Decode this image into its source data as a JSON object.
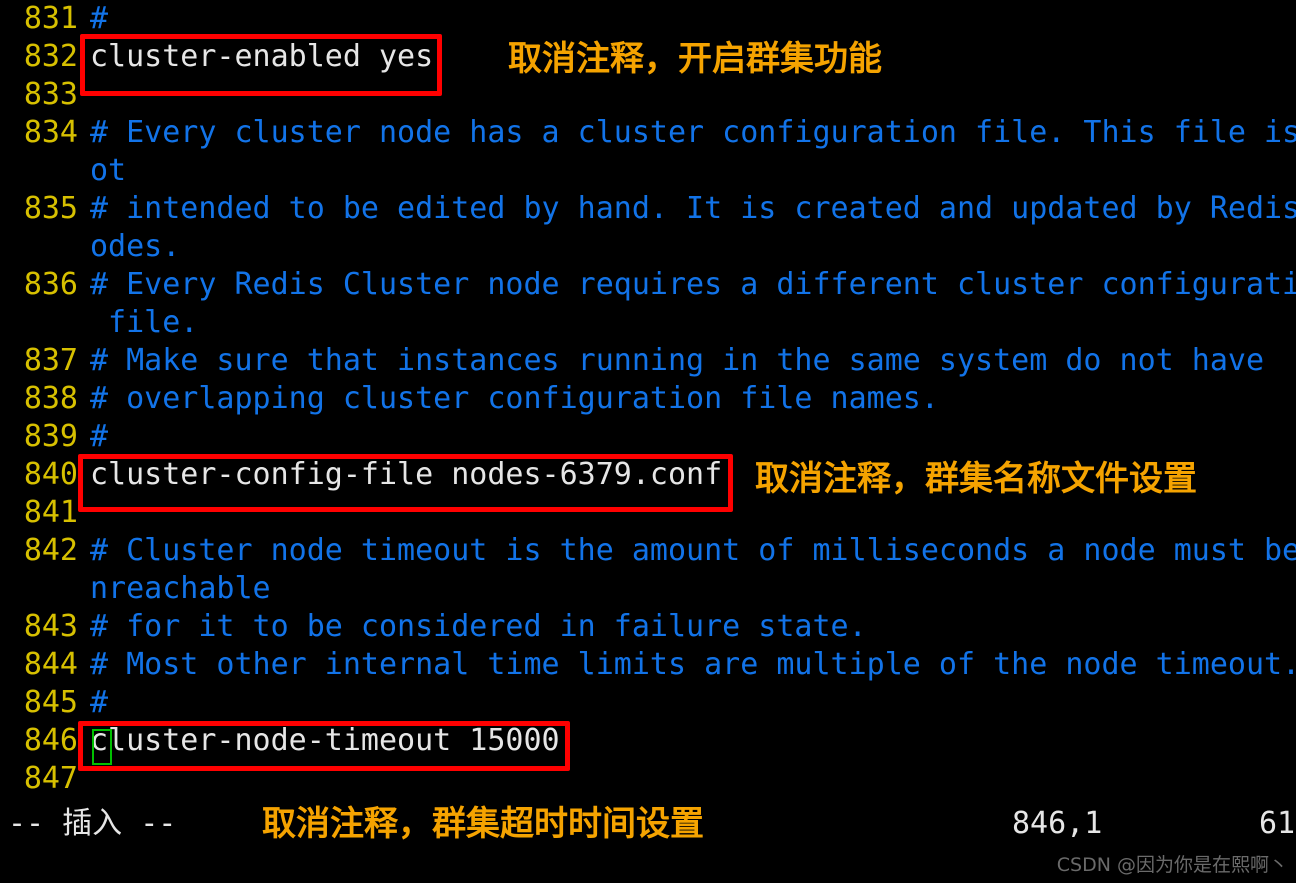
{
  "editor": {
    "app": "vim",
    "background_color": "#000000",
    "comment_color": "#1273e8",
    "code_color": "#e6e6e6",
    "lineno_color": "#d7c000",
    "highlight_color": "#ff0000",
    "annotation_color": "#f5a300",
    "cursor_color": "#00c000",
    "lines": [
      {
        "no": "831",
        "text": "#",
        "kind": "comment",
        "wrap": ""
      },
      {
        "no": "832",
        "text": "cluster-enabled yes",
        "kind": "code",
        "wrap": ""
      },
      {
        "no": "833",
        "text": "",
        "kind": "comment",
        "wrap": ""
      },
      {
        "no": "834",
        "text": "# Every cluster node has a cluster configuration file. This file is n",
        "kind": "comment",
        "wrap": "ot"
      },
      {
        "no": "835",
        "text": "# intended to be edited by hand. It is created and updated by Redis n",
        "kind": "comment",
        "wrap": "odes."
      },
      {
        "no": "836",
        "text": "# Every Redis Cluster node requires a different cluster configuration",
        "kind": "comment",
        "wrap": " file."
      },
      {
        "no": "837",
        "text": "# Make sure that instances running in the same system do not have",
        "kind": "comment",
        "wrap": ""
      },
      {
        "no": "838",
        "text": "# overlapping cluster configuration file names.",
        "kind": "comment",
        "wrap": ""
      },
      {
        "no": "839",
        "text": "#",
        "kind": "comment",
        "wrap": ""
      },
      {
        "no": "840",
        "text": "cluster-config-file nodes-6379.conf",
        "kind": "code",
        "wrap": ""
      },
      {
        "no": "841",
        "text": "",
        "kind": "comment",
        "wrap": ""
      },
      {
        "no": "842",
        "text": "# Cluster node timeout is the amount of milliseconds a node must be u",
        "kind": "comment",
        "wrap": "nreachable"
      },
      {
        "no": "843",
        "text": "# for it to be considered in failure state.",
        "kind": "comment",
        "wrap": ""
      },
      {
        "no": "844",
        "text": "# Most other internal time limits are multiple of the node timeout.",
        "kind": "comment",
        "wrap": ""
      },
      {
        "no": "845",
        "text": "#",
        "kind": "comment",
        "wrap": ""
      },
      {
        "no": "846",
        "text": "cluster-node-timeout 15000",
        "kind": "code",
        "wrap": ""
      },
      {
        "no": "847",
        "text": "",
        "kind": "comment",
        "wrap": ""
      }
    ]
  },
  "annotations": [
    {
      "id": "annot-cluster-enabled",
      "text": "取消注释，开启群集功能"
    },
    {
      "id": "annot-cluster-config-file",
      "text": "取消注释，群集名称文件设置"
    },
    {
      "id": "annot-cluster-node-timeout",
      "text": "取消注释，群集超时时间设置"
    }
  ],
  "status_bar": {
    "mode": "-- 插入 --",
    "position": "846,1",
    "percent": "61"
  },
  "watermark": {
    "text": "CSDN @因为你是在熙啊丶"
  }
}
